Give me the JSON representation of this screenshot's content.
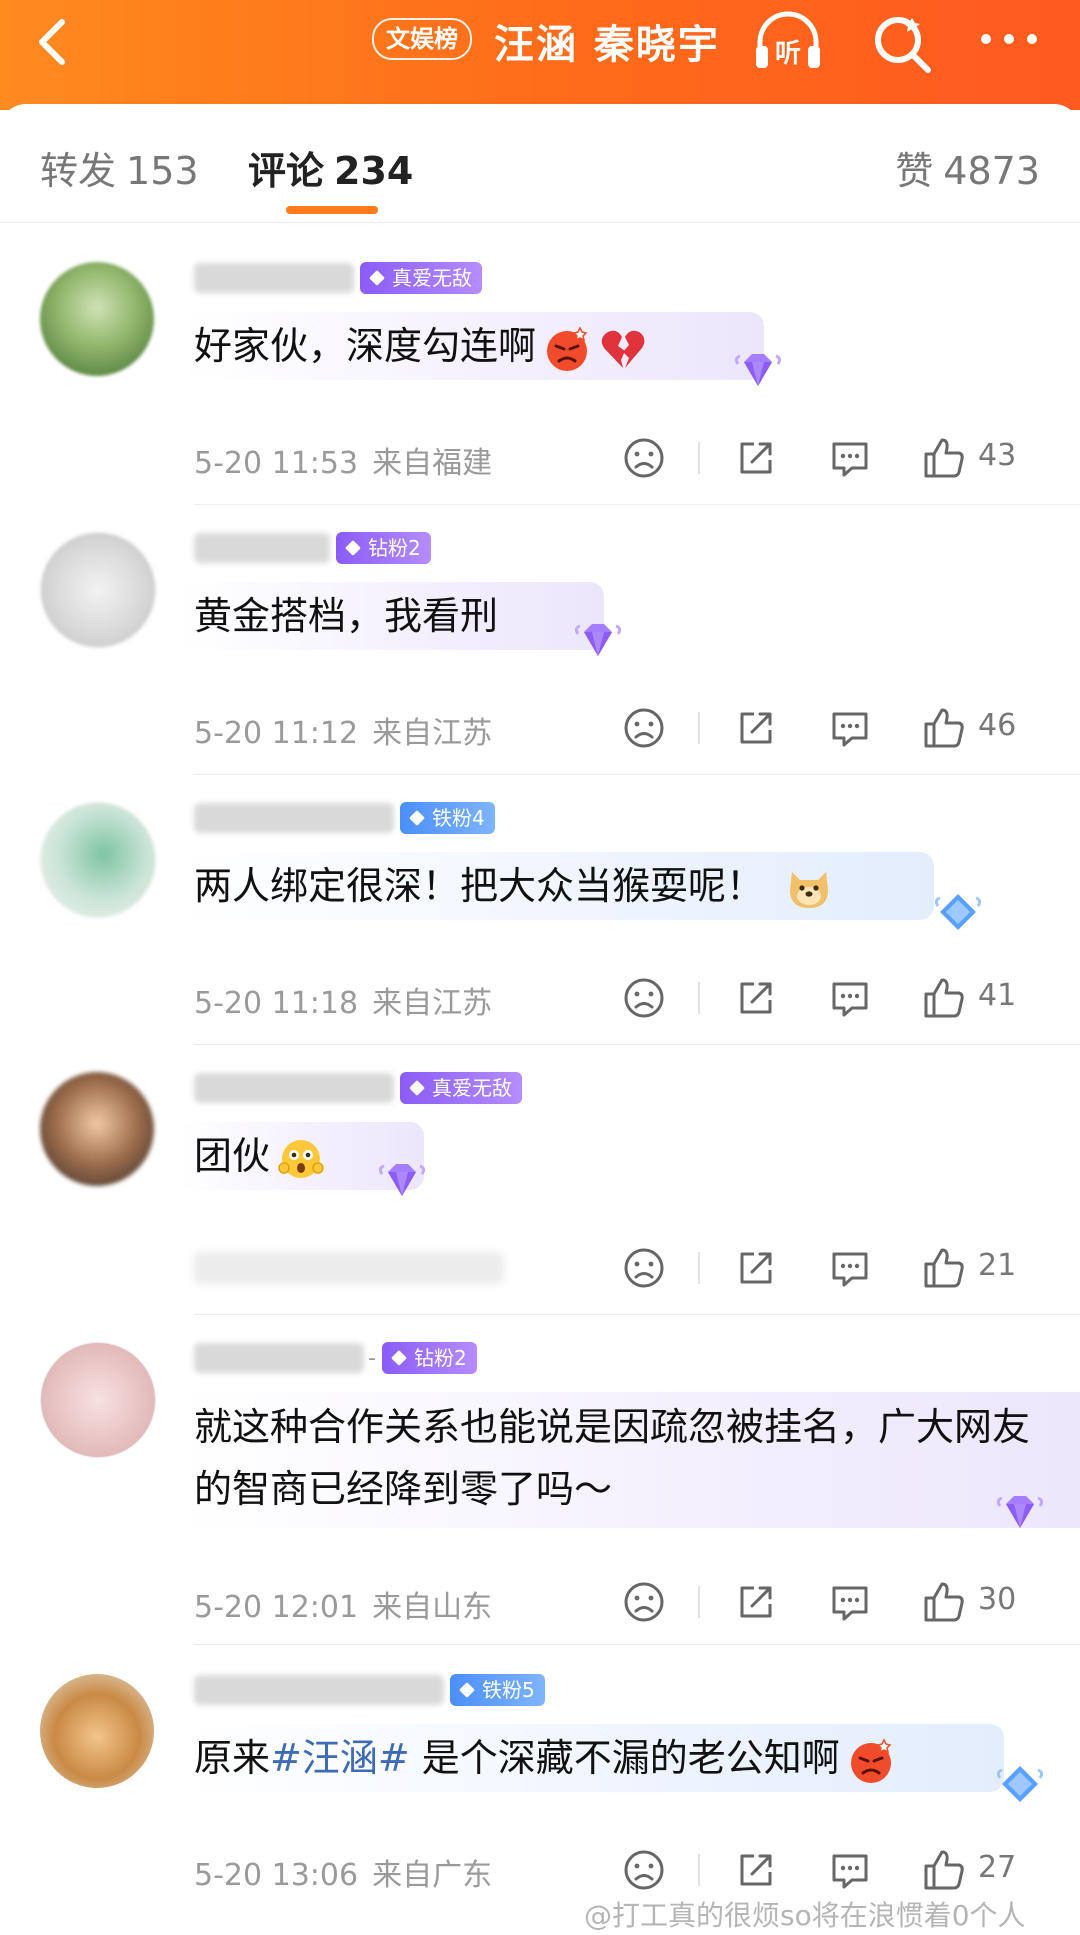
{
  "header": {
    "rank_tag": "文娱榜",
    "title": "汪涵 秦晓宇",
    "listen_label": "听",
    "accent": "#ff6a1a"
  },
  "tabs": [
    {
      "label": "转发",
      "count": "153"
    },
    {
      "label": "评论",
      "count": "234"
    },
    {
      "label": "赞",
      "count": "4873"
    }
  ],
  "comments": [
    {
      "badge": "真爱无敌",
      "badge_color": "purple",
      "text": "好家伙，深度勾连啊",
      "emojis": [
        "angry-emoji",
        "broken-heart-emoji"
      ],
      "date": "5-20 11:53",
      "location": "来自福建",
      "likes": "43"
    },
    {
      "badge": "钻粉2",
      "badge_color": "purple",
      "text": "黄金搭档，我看刑",
      "emojis": [],
      "date": "5-20 11:12",
      "location": "来自江苏",
      "likes": "46"
    },
    {
      "badge": "铁粉4",
      "badge_color": "blue",
      "text": "两人绑定很深！把大众当猴耍呢！",
      "emojis": [
        "doge-emoji"
      ],
      "date": "5-20 11:18",
      "location": "来自江苏",
      "likes": "41"
    },
    {
      "badge": "真爱无敌",
      "badge_color": "purple",
      "text": "团伙",
      "emojis": [
        "shocked-emoji"
      ],
      "date": "",
      "location": "",
      "likes": "21"
    },
    {
      "badge": "钻粉2",
      "badge_color": "purple",
      "text": "就这种合作关系也能说是因疏忽被挂名，广大网友的智商已经降到零了吗～",
      "emojis": [],
      "date": "5-20 12:01",
      "location": "来自山东",
      "likes": "30"
    },
    {
      "badge": "铁粉5",
      "badge_color": "blue",
      "text_before": "原来",
      "topic": "#汪涵#",
      "text_after": " 是个深藏不漏的老公知啊",
      "emojis": [
        "angry-emoji"
      ],
      "date": "5-20 13:06",
      "location": "来自广东",
      "likes": "27"
    }
  ],
  "watermark": "@打工真的很烦so将在浪惯着0个人"
}
